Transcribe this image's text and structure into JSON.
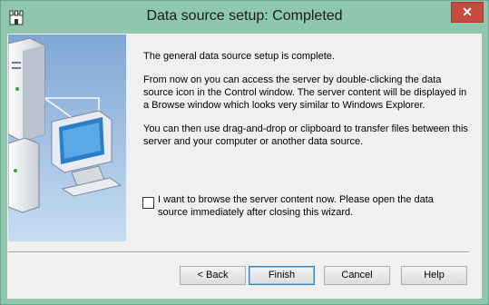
{
  "window": {
    "title": "Data source setup: Completed",
    "close_label": "✕",
    "titlebar_color": "#8ec7ae",
    "close_color": "#c74a3e"
  },
  "icons": {
    "app": "castle-icon",
    "side": "network-servers-computer-icon"
  },
  "content": {
    "paragraph1": "The general data source setup is complete.",
    "paragraph2": "From now on you can access the server by double-clicking the data source icon in the Control window. The server content will be displayed in a Browse window which looks very similar to Windows Explorer.",
    "paragraph3": "You can then use drag-and-drop or clipboard to transfer files between this server and your computer or another data source."
  },
  "browse_option": {
    "label": "I want to browse the server content now. Please open the data source immediately after closing this wizard.",
    "checked": false
  },
  "buttons": {
    "back": "< Back",
    "finish": "Finish",
    "cancel": "Cancel",
    "help": "Help"
  }
}
